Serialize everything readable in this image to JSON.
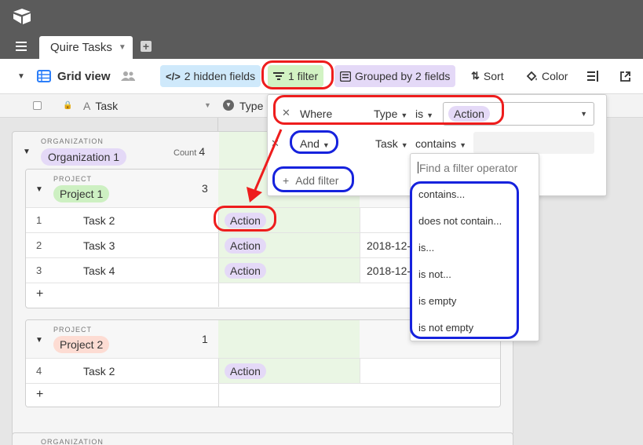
{
  "app": {
    "logo_icon": "airtable-logo-icon"
  },
  "tabs": {
    "active_label": "Quire Tasks"
  },
  "viewbar": {
    "view_name": "Grid view",
    "hidden_fields": "2 hidden fields",
    "filter": "1 filter",
    "grouped": "Grouped by 2 fields",
    "sort": "Sort",
    "color": "Color"
  },
  "columns": {
    "task": "Task",
    "type": "Type"
  },
  "organization": {
    "label": "ORGANIZATION",
    "name": "Organization 1",
    "count_label": "Count",
    "count": "4",
    "next_label": "ORGANIZATION"
  },
  "projects": [
    {
      "label": "PROJECT",
      "name": "Project 1",
      "count": "3",
      "rows": [
        {
          "num": "1",
          "task": "Task 2",
          "type": "Action",
          "date": ""
        },
        {
          "num": "2",
          "task": "Task 3",
          "type": "Action",
          "date": "2018-12-"
        },
        {
          "num": "3",
          "task": "Task 4",
          "type": "Action",
          "date": "2018-12-"
        }
      ]
    },
    {
      "label": "PROJECT",
      "name": "Project 2",
      "count": "1",
      "rows": [
        {
          "num": "4",
          "task": "Task 2",
          "type": "Action",
          "date": ""
        }
      ]
    }
  ],
  "add_row": "+",
  "filter_popup": {
    "row1": {
      "conjunction": "Where",
      "field": "Type",
      "operator": "is",
      "value": "Action"
    },
    "row2": {
      "conjunction": "And",
      "field": "Task",
      "operator": "contains"
    },
    "add_filter": "Add filter"
  },
  "operator_menu": {
    "search_placeholder": "Find a filter operator",
    "options": [
      "contains...",
      "does not contain...",
      "is...",
      "is not...",
      "is empty",
      "is not empty"
    ]
  },
  "colors": {
    "header": "#5b5b5b",
    "hidden_fields_bg": "#cfe9fb",
    "filter_bg": "#d2f3c3",
    "grouped_bg": "#e4d9f7",
    "action_pill": "#e4d9f7",
    "project1_pill": "#cdf0c2",
    "project2_pill": "#fddcd3",
    "annotation_red": "#ee1d1d",
    "annotation_blue": "#1622dd"
  }
}
